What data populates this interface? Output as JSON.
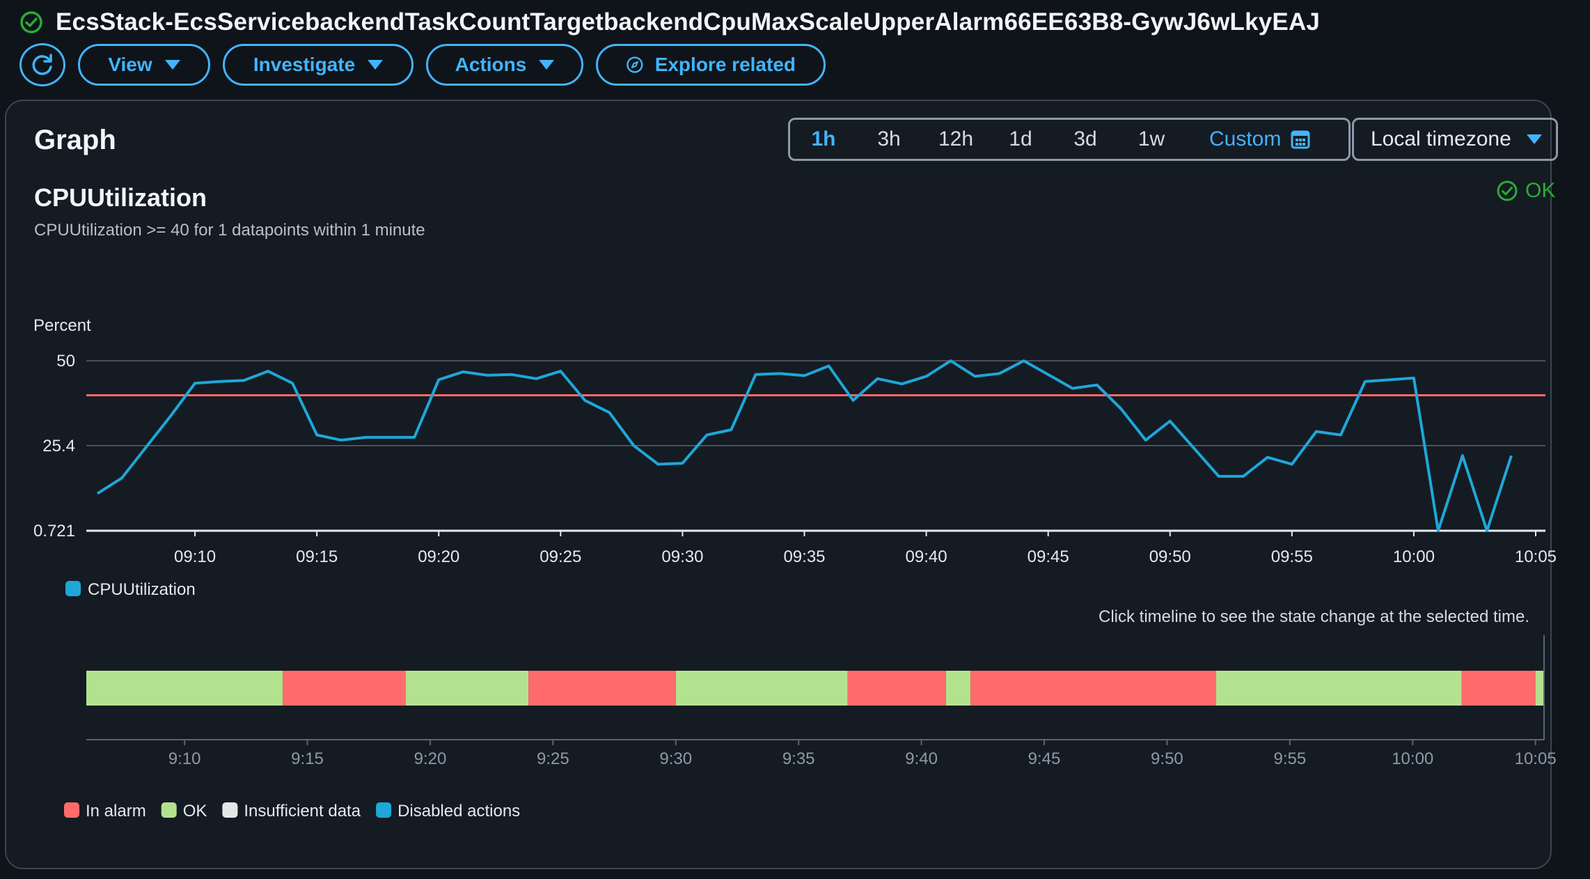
{
  "header": {
    "title": "EcsStack-EcsServicebackendTaskCountTargetbackendCpuMaxScaleUpperAlarm66EE63B8-GywJ6wLkyEAJ",
    "status_icon": "check-circle-icon"
  },
  "toolbar": {
    "refresh_icon": "refresh-icon",
    "view_label": "View",
    "investigate_label": "Investigate",
    "actions_label": "Actions",
    "explore_label": "Explore related"
  },
  "panel": {
    "title": "Graph",
    "time_ranges": [
      "1h",
      "3h",
      "12h",
      "1d",
      "3d",
      "1w"
    ],
    "active_range": "1h",
    "custom_label": "Custom",
    "timezone_label": "Local timezone"
  },
  "metric": {
    "title": "CPUUtilization",
    "subtitle": "CPUUtilization >= 40 for 1 datapoints within 1 minute",
    "state": "OK",
    "colors": {
      "line": "#1ea7d8",
      "threshold": "#ff6b6b",
      "ok": "#29ad32"
    }
  },
  "chart_data": [
    {
      "type": "line",
      "ylabel": "Percent",
      "ylim": [
        0.721,
        50
      ],
      "yticks": [
        50,
        25.4,
        0.721
      ],
      "ytick_labels": [
        "50",
        "25.4",
        "0.721"
      ],
      "xlim": [
        "09:06",
        "10:05"
      ],
      "xticks": [
        "09:10",
        "09:15",
        "09:20",
        "09:25",
        "09:30",
        "09:35",
        "09:40",
        "09:45",
        "09:50",
        "09:55",
        "10:00",
        "10:05"
      ],
      "threshold": 40,
      "grid": true,
      "legend": "bottom-left",
      "series": [
        {
          "name": "CPUUtilization",
          "color": "#1ea7d8",
          "x": [
            "09:06",
            "09:07",
            "09:08",
            "09:09",
            "09:10",
            "09:11",
            "09:12",
            "09:13",
            "09:14",
            "09:15",
            "09:16",
            "09:17",
            "09:18",
            "09:19",
            "09:20",
            "09:21",
            "09:22",
            "09:23",
            "09:24",
            "09:25",
            "09:26",
            "09:27",
            "09:28",
            "09:29",
            "09:30",
            "09:31",
            "09:32",
            "09:33",
            "09:34",
            "09:35",
            "09:36",
            "09:37",
            "09:38",
            "09:39",
            "09:40",
            "09:41",
            "09:42",
            "09:43",
            "09:44",
            "09:45",
            "09:46",
            "09:47",
            "09:48",
            "09:49",
            "09:50",
            "09:51",
            "09:52",
            "09:53",
            "09:54",
            "09:55",
            "09:56",
            "09:57",
            "09:58",
            "09:59",
            "10:00",
            "10:01",
            "10:02",
            "10:03",
            "10:04"
          ],
          "values": [
            11.5,
            16,
            25,
            34,
            43.5,
            44,
            44.3,
            47,
            43.5,
            28.5,
            27,
            27.8,
            27.8,
            27.8,
            44.5,
            46.8,
            45.8,
            46,
            44.8,
            47,
            38.5,
            35,
            25.4,
            20,
            20.3,
            28.5,
            30,
            46,
            46.3,
            45.7,
            48.5,
            38.5,
            44.8,
            43.3,
            45.5,
            50,
            45.5,
            46.3,
            50,
            46,
            42,
            43,
            36,
            27,
            32.5,
            24.5,
            16.5,
            16.5,
            22,
            20,
            29.5,
            28.5,
            44,
            44.5,
            45,
            0.721,
            22.5,
            0.721,
            22.5
          ]
        }
      ]
    },
    {
      "type": "timeline",
      "title": "",
      "hint": "Click timeline to see the state change at the selected time.",
      "xlim": [
        "09:06",
        "10:05"
      ],
      "xticks": [
        "9:10",
        "9:15",
        "9:20",
        "9:25",
        "9:30",
        "9:35",
        "9:40",
        "9:45",
        "9:50",
        "9:55",
        "10:00",
        "10:05"
      ],
      "segments": [
        {
          "start": "09:06",
          "end": "09:14",
          "state": "OK"
        },
        {
          "start": "09:14",
          "end": "09:19",
          "state": "In alarm"
        },
        {
          "start": "09:19",
          "end": "09:24",
          "state": "OK"
        },
        {
          "start": "09:24",
          "end": "09:30",
          "state": "In alarm"
        },
        {
          "start": "09:30",
          "end": "09:37",
          "state": "OK"
        },
        {
          "start": "09:37",
          "end": "09:41",
          "state": "In alarm"
        },
        {
          "start": "09:41",
          "end": "09:42",
          "state": "OK"
        },
        {
          "start": "09:42",
          "end": "09:52",
          "state": "In alarm"
        },
        {
          "start": "09:52",
          "end": "10:02",
          "state": "OK"
        },
        {
          "start": "10:02",
          "end": "10:05",
          "state": "In alarm"
        },
        {
          "start": "10:05",
          "end": "10:06",
          "state": "OK"
        }
      ],
      "legend": [
        {
          "label": "In alarm",
          "color": "#ff6b6b"
        },
        {
          "label": "OK",
          "color": "#b3e28e"
        },
        {
          "label": "Insufficient data",
          "color": "#e6e6e6"
        },
        {
          "label": "Disabled actions",
          "color": "#1ea7d8"
        }
      ]
    }
  ]
}
